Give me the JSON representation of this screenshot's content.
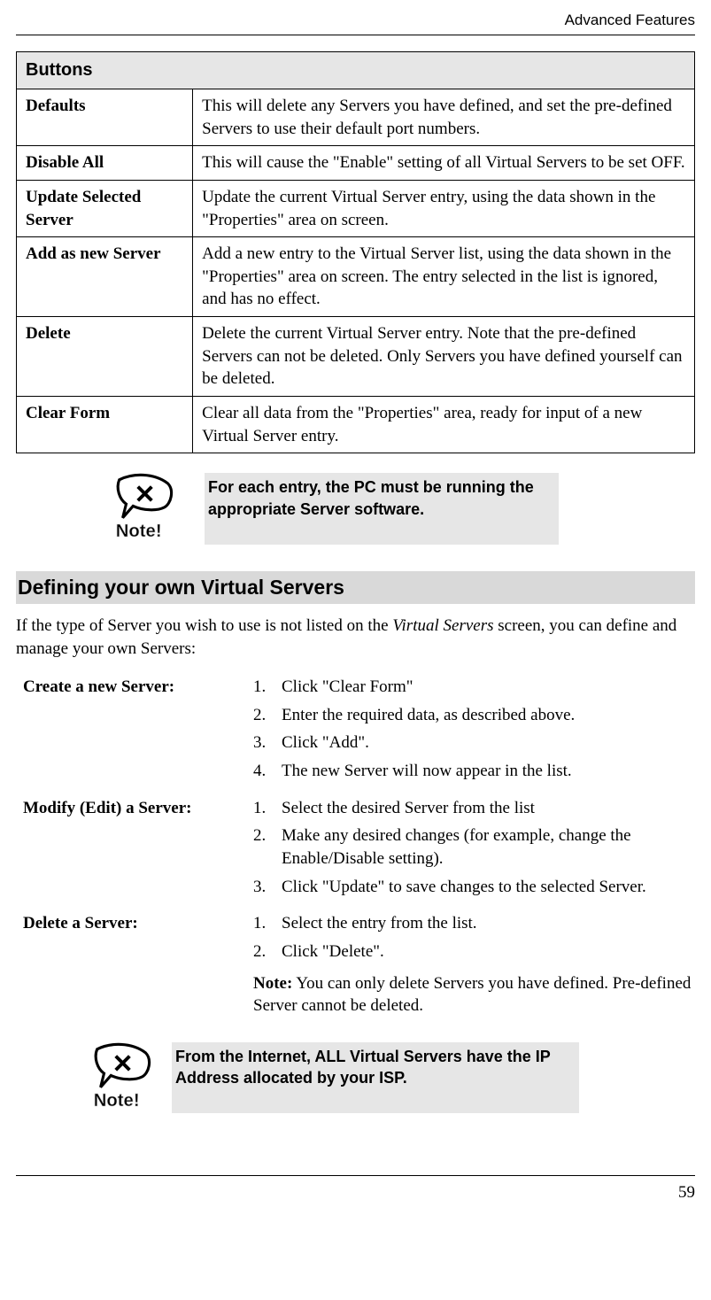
{
  "header": {
    "section_label": "Advanced Features"
  },
  "buttons_table": {
    "header": "Buttons",
    "rows": [
      {
        "label": "Defaults",
        "desc": "This will delete any Servers you have defined, and set the pre-defined Servers to use their default port numbers."
      },
      {
        "label": "Disable All",
        "desc": "This will cause the \"Enable\" setting of all Virtual Servers to be set OFF."
      },
      {
        "label": "Update Selected Server",
        "desc": "Update the current Virtual Server entry, using the data shown in the \"Properties\" area on screen."
      },
      {
        "label": "Add as new Server",
        "desc": "Add a new entry to the Virtual Server list, using the data shown in the \"Properties\" area on screen. The entry selected in the list is ignored, and has no effect."
      },
      {
        "label": "Delete",
        "desc": "Delete the current Virtual Server entry. Note that the pre-defined Servers can not be deleted. Only Servers you have defined yourself can be deleted."
      },
      {
        "label": "Clear Form",
        "desc": "Clear all data from the \"Properties\" area, ready for input of a new Virtual Server entry."
      }
    ]
  },
  "note1": {
    "icon_label": "Note!",
    "text": "For each entry, the PC must be running the appropriate Server software."
  },
  "section": {
    "title": "Defining your own Virtual Servers",
    "intro_pre": "If the type of Server you wish to use is not listed on the ",
    "intro_italic": "Virtual Servers",
    "intro_post": " screen, you can define and manage your own Servers:"
  },
  "procedures": [
    {
      "label": "Create a new Server:",
      "steps": [
        "Click \"Clear Form\"",
        "Enter the required data, as described above.",
        "Click \"Add\".",
        "The new Server will now appear in the list."
      ]
    },
    {
      "label": "Modify (Edit) a Server:",
      "steps": [
        "Select the desired Server from the list",
        "Make any desired changes (for example, change the Enable/Disable setting).",
        "Click \"Update\" to save changes to the selected Server."
      ]
    },
    {
      "label": "Delete a Server:",
      "steps": [
        "Select the entry from the list.",
        "Click \"Delete\"."
      ],
      "note_label": "Note:",
      "note_text": "  You can only delete Servers you have defined. Pre-defined Server cannot be deleted."
    }
  ],
  "note2": {
    "icon_label": "Note!",
    "text": "From the Internet, ALL Virtual Servers have the IP Address allocated by your ISP."
  },
  "footer": {
    "page_number": "59"
  }
}
